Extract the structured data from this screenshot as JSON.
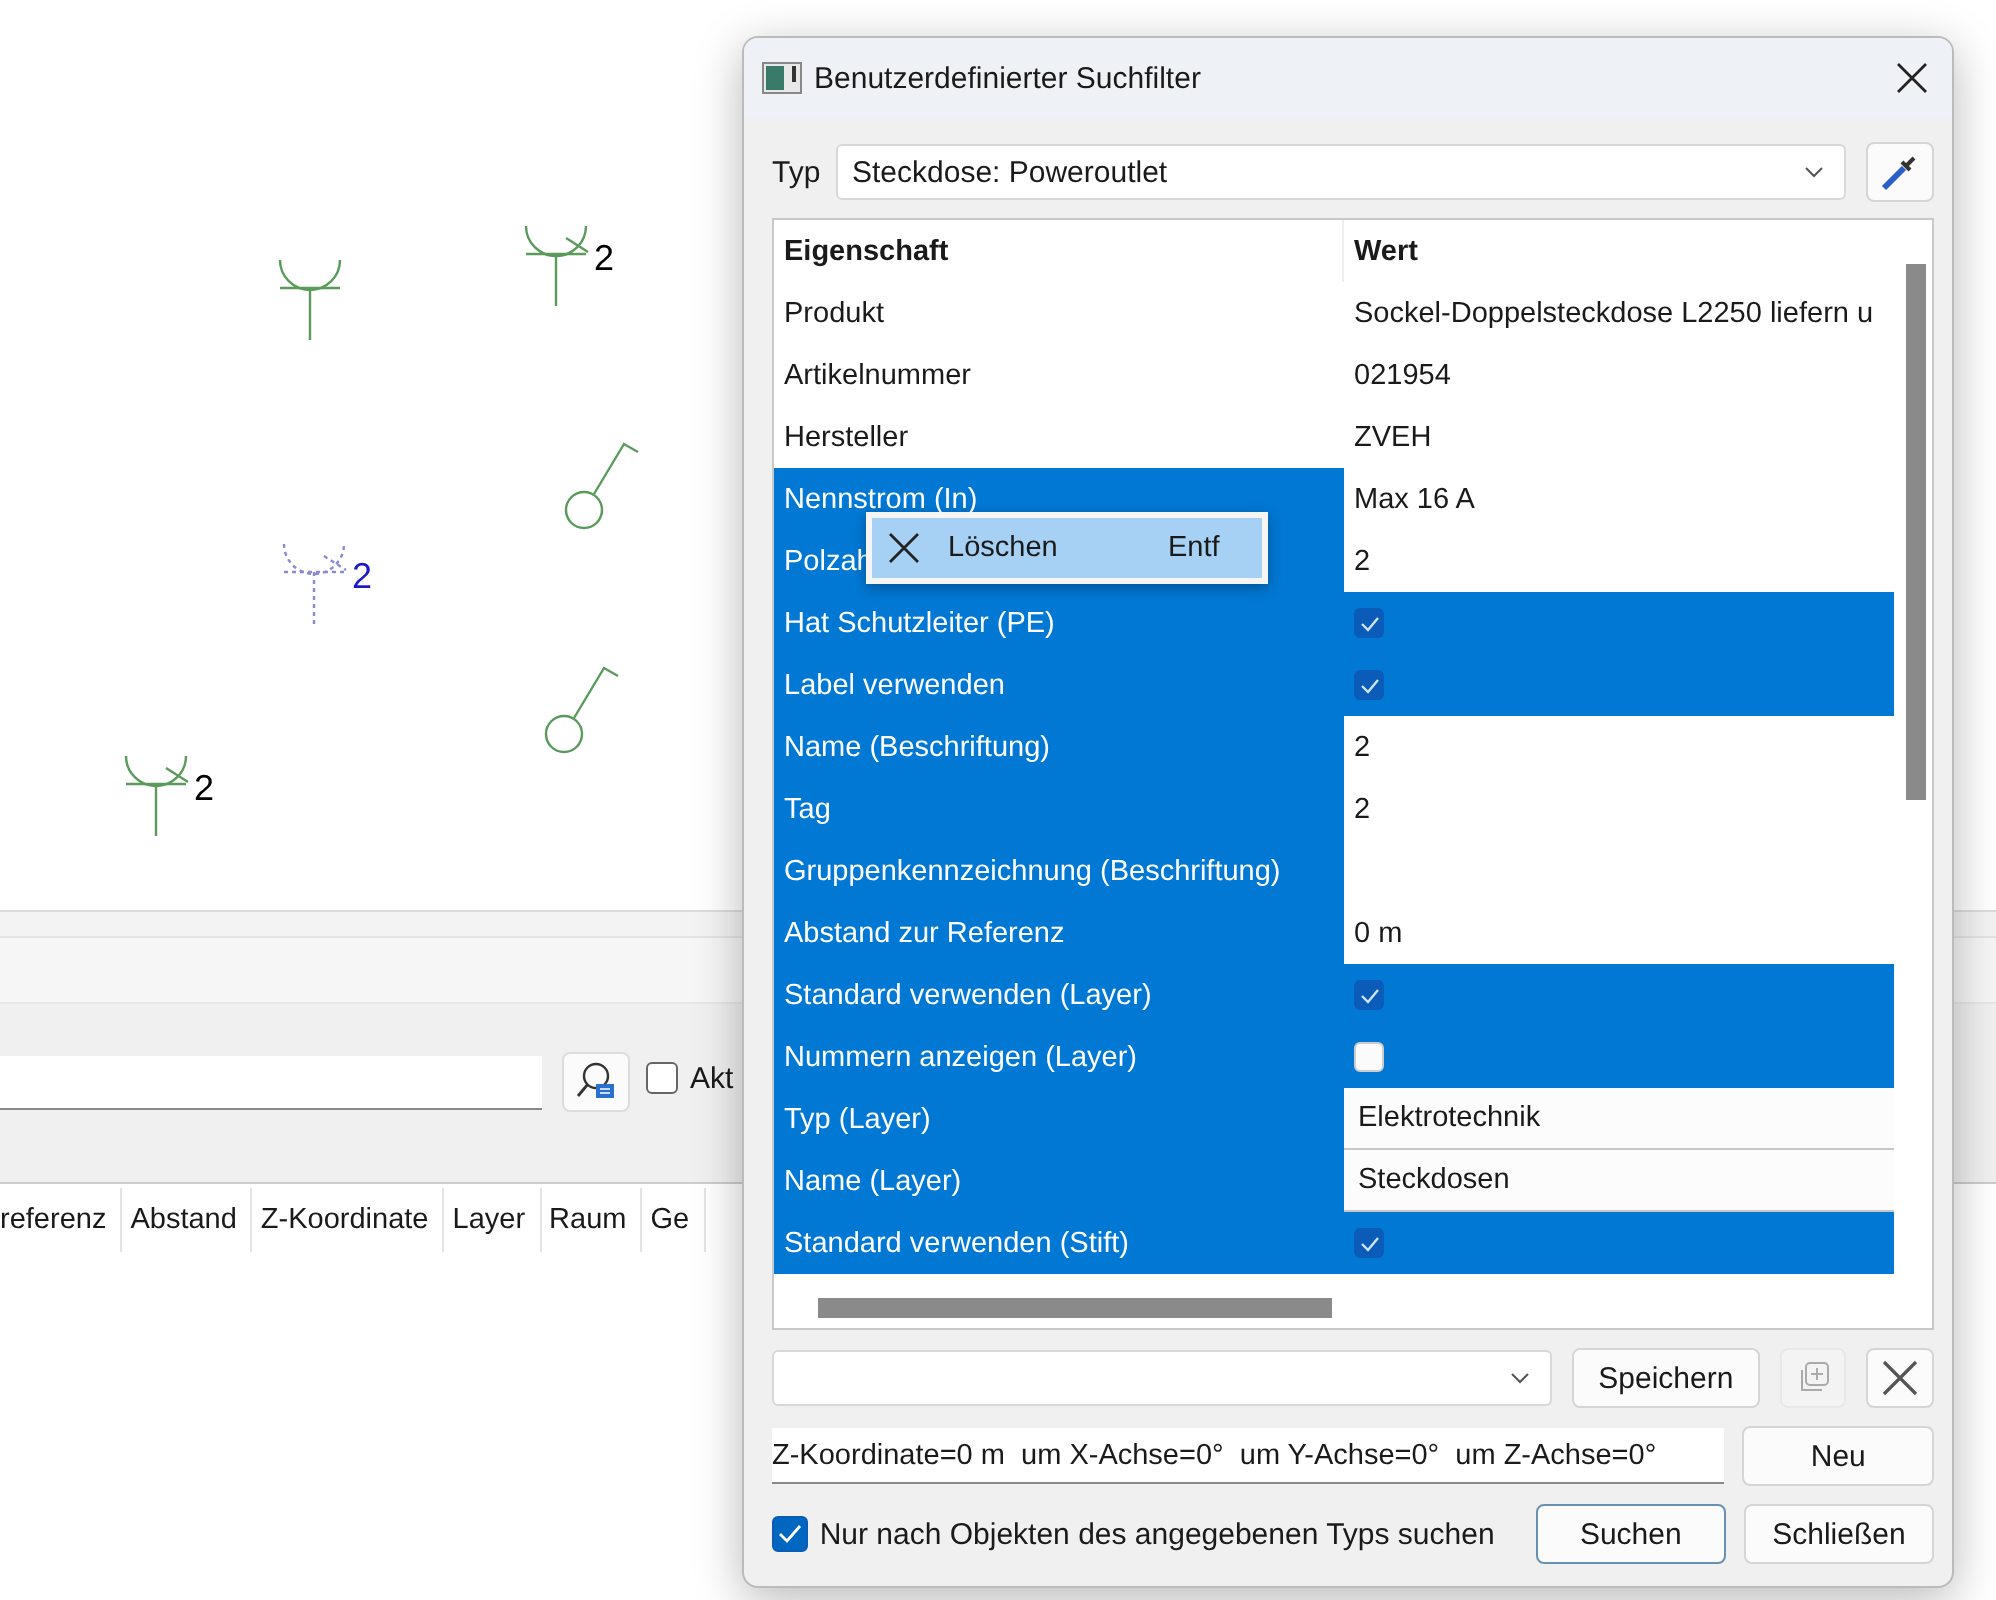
{
  "canvas": {
    "symbols": [
      {
        "kind": "socket",
        "selected": false
      },
      {
        "kind": "socket",
        "label": "2",
        "selected": false
      },
      {
        "kind": "switch",
        "selected": false
      },
      {
        "kind": "socket",
        "label": "2",
        "selected": true
      },
      {
        "kind": "switch",
        "selected": false
      },
      {
        "kind": "socket",
        "label": "2",
        "selected": false
      }
    ]
  },
  "search": {
    "checkbox_label": "Akt",
    "checked": false
  },
  "columns": [
    "referenz",
    "Abstand",
    "Z-Koordinate",
    "Layer",
    "Raum",
    "Ge"
  ],
  "dialog": {
    "title": "Benutzerdefinierter Suchfilter",
    "type_label": "Typ",
    "type_value": "Steckdose: Poweroutlet",
    "table": {
      "columns": [
        "Eigenschaft",
        "Wert"
      ],
      "rows": [
        {
          "name": "Produkt",
          "kind": "text",
          "value": "Sockel-Doppelsteckdose L2250 liefern u",
          "selected": false
        },
        {
          "name": "Artikelnummer",
          "kind": "text",
          "value": "021954",
          "selected": false
        },
        {
          "name": "Hersteller",
          "kind": "text",
          "value": "ZVEH",
          "selected": false
        },
        {
          "name": "Nennstrom (In)",
          "kind": "text",
          "value": "Max 16 A",
          "selected": true
        },
        {
          "name": "Polzah",
          "kind": "text",
          "value": "2",
          "selected": true
        },
        {
          "name": "Hat Schutzleiter (PE)",
          "kind": "check",
          "checked": true,
          "selected": true
        },
        {
          "name": "Label verwenden",
          "kind": "check",
          "checked": true,
          "selected": true
        },
        {
          "name": "Name (Beschriftung)",
          "kind": "text",
          "value": "2",
          "selected": true
        },
        {
          "name": "Tag",
          "kind": "text",
          "value": "2",
          "selected": true
        },
        {
          "name": "Gruppenkennzeichnung (Beschriftung)",
          "kind": "text",
          "selected": true
        },
        {
          "name": "Abstand zur Referenz",
          "kind": "text",
          "value": "0 m",
          "selected": true
        },
        {
          "name": "Standard verwenden (Layer)",
          "kind": "check",
          "checked": true,
          "selected": true
        },
        {
          "name": "Nummern anzeigen (Layer)",
          "kind": "check",
          "checked": false,
          "selected": true
        },
        {
          "name": "Typ (Layer)",
          "kind": "field",
          "value": "Elektrotechnik",
          "selected": true
        },
        {
          "name": "Name (Layer)",
          "kind": "field",
          "value": "Steckdosen",
          "selected": true
        },
        {
          "name": "Standard verwenden (Stift)",
          "kind": "check",
          "checked": true,
          "selected": true
        }
      ]
    },
    "context_menu": {
      "label": "Löschen",
      "shortcut": "Entf"
    },
    "save_button": "Speichern",
    "filter_text": "Z-Koordinate=0 m  um X-Achse=0°  um Y-Achse=0°  um Z-Achse=0°",
    "new_button": "Neu",
    "only_type": {
      "label": "Nur nach Objekten des angegebenen Typs suchen",
      "checked": true
    },
    "search_button": "Suchen",
    "close_button": "Schließen"
  }
}
